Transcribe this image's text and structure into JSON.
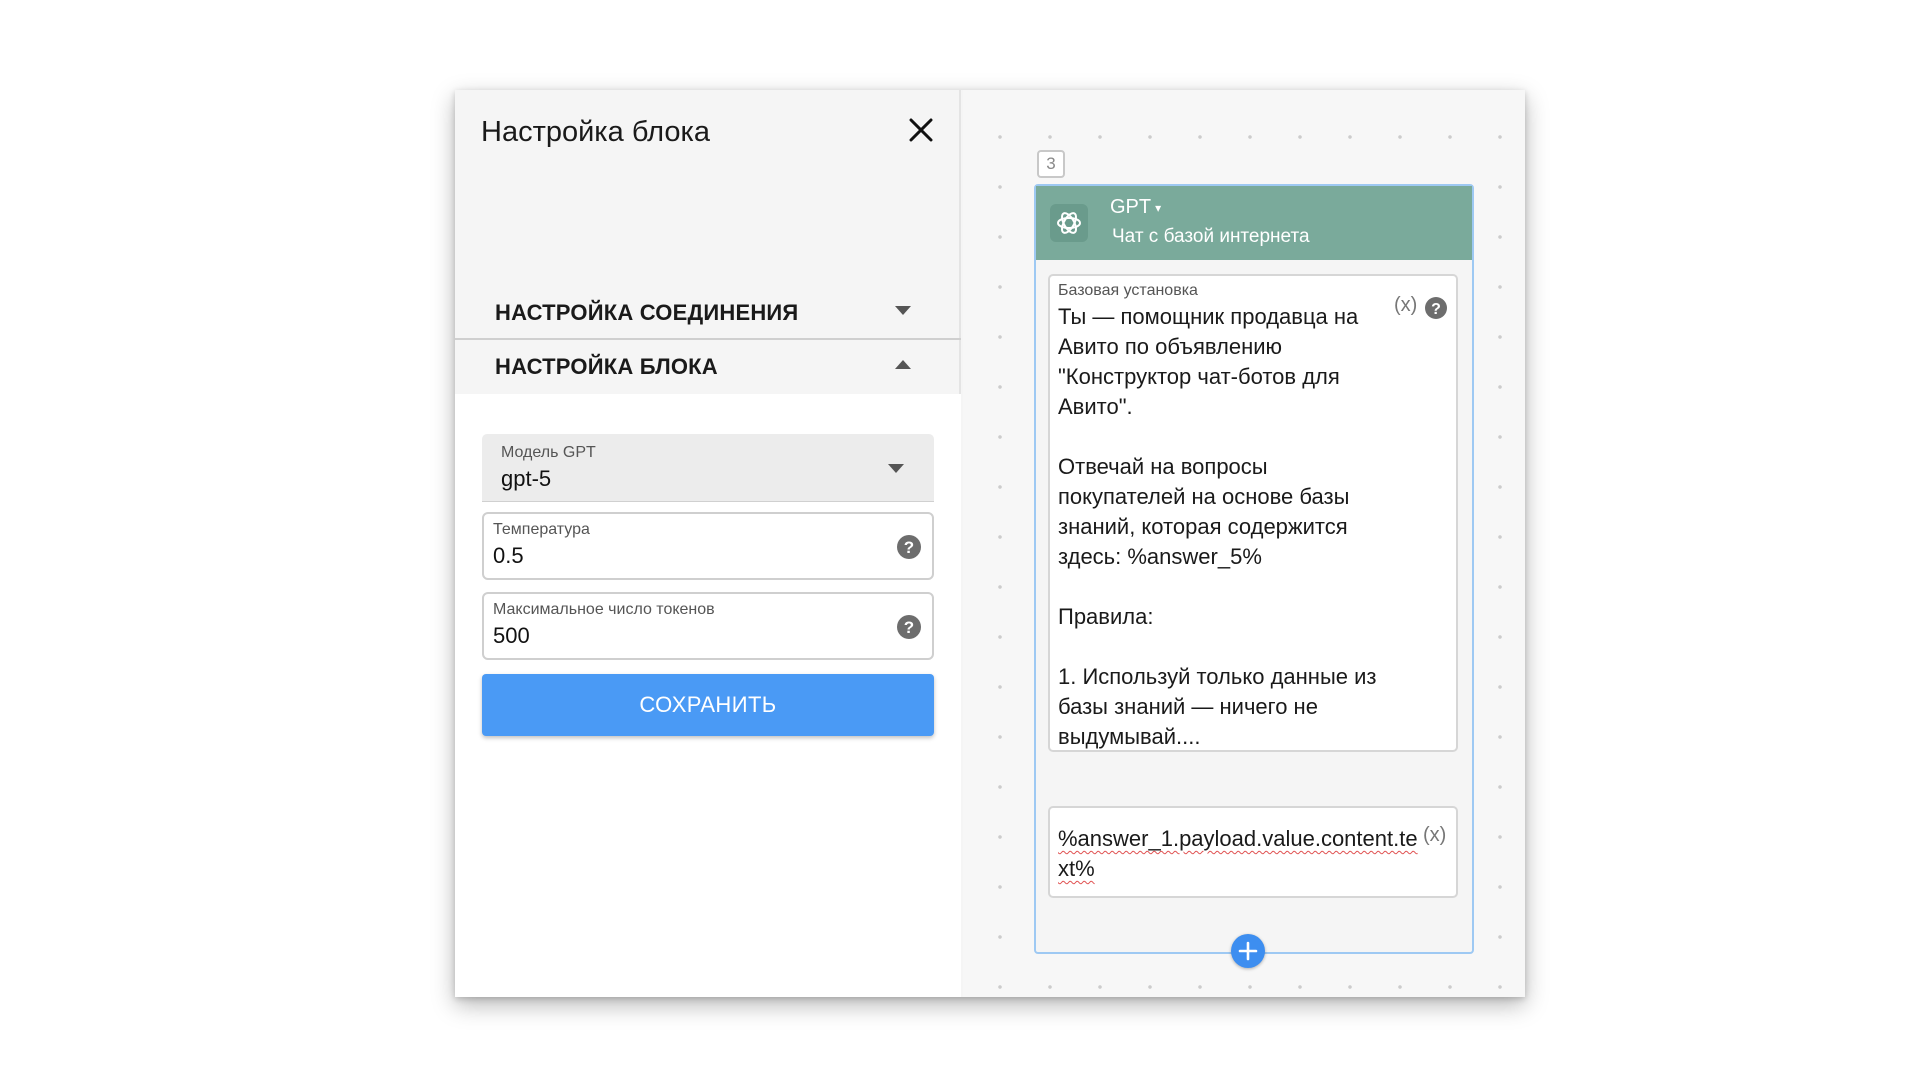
{
  "panel": {
    "title": "Настройка блока",
    "sections": {
      "connection": "НАСТРОЙКА СОЕДИНЕНИЯ",
      "block": "НАСТРОЙКА БЛОКА"
    },
    "fields": {
      "model": {
        "label": "Модель GPT",
        "value": "gpt-5"
      },
      "temperature": {
        "label": "Температура",
        "value": "0.5"
      },
      "max_tokens": {
        "label": "Максимальное число токенов",
        "value": "500"
      }
    },
    "save_label": "СОХРАНИТЬ"
  },
  "canvas": {
    "node_number": "3",
    "node": {
      "type": "GPT",
      "subtitle": "Чат с базой интернета",
      "prompt_label": "Базовая установка",
      "prompt_text": "Ты — помощник продавца на Авито по объявлению \"Конструктор чат-ботов для Авито\".\n\nОтвечай на вопросы покупателей на основе базы знаний, которая содержится здесь: %answer_5%\n\nПравила:\n\n1. Используй только данные из базы знаний — ничего не выдумывай....",
      "input_text": "%answer_1.payload.value.content.text%",
      "var_label": "(x)"
    }
  },
  "colors": {
    "accent": "#4a9af5",
    "node_header": "#7aaa9b",
    "node_border": "#9ec9f3"
  },
  "icons": [
    "close-icon",
    "chevron-down-icon",
    "chevron-up-icon",
    "help-icon",
    "gpt-logo-icon",
    "plus-icon"
  ]
}
